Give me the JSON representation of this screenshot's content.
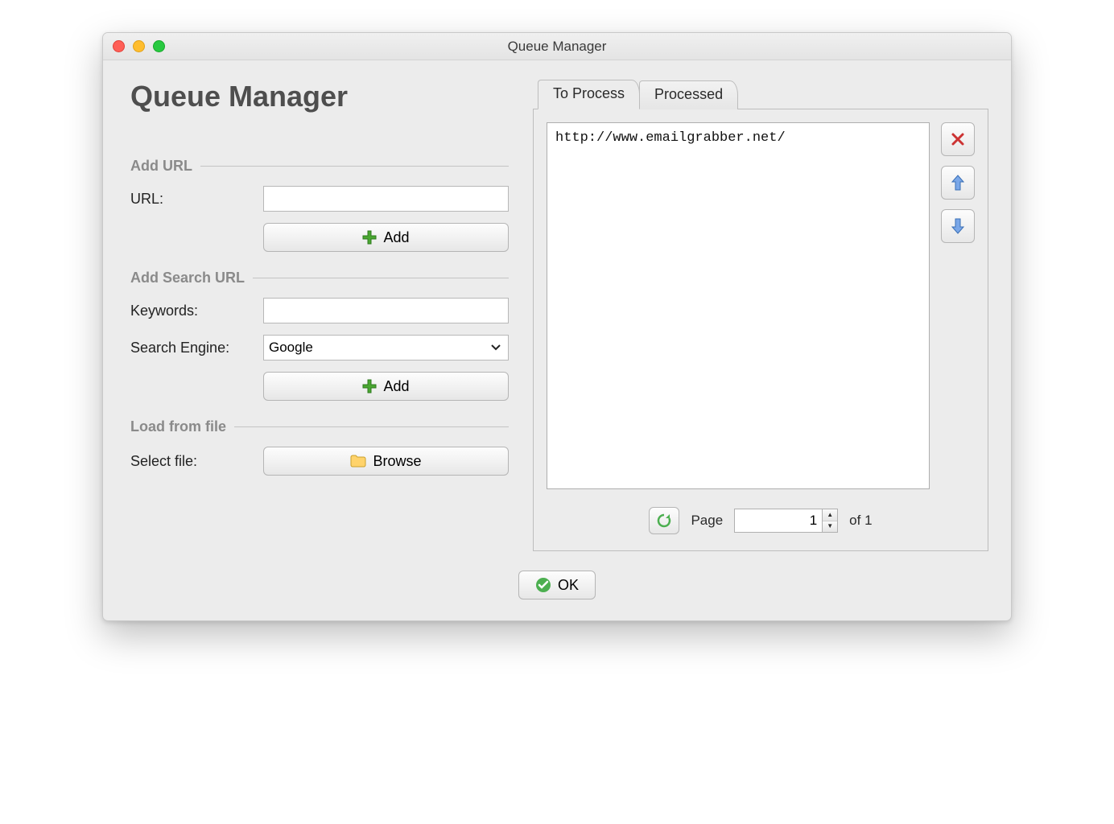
{
  "window": {
    "title": "Queue Manager"
  },
  "page_title": "Queue Manager",
  "sections": {
    "add_url": {
      "header": "Add URL",
      "url_label": "URL:",
      "url_value": "",
      "add_btn": "Add"
    },
    "add_search": {
      "header": "Add Search URL",
      "keywords_label": "Keywords:",
      "keywords_value": "",
      "engine_label": "Search Engine:",
      "engine_selected": "Google",
      "add_btn": "Add"
    },
    "load_file": {
      "header": "Load from file",
      "select_label": "Select file:",
      "browse_btn": "Browse"
    }
  },
  "tabs": {
    "to_process": "To Process",
    "processed": "Processed",
    "active": "to_process"
  },
  "queue": {
    "items": [
      "http://www.emailgrabber.net/"
    ]
  },
  "pager": {
    "label": "Page",
    "current": "1",
    "of_label": "of 1"
  },
  "footer": {
    "ok": "OK"
  }
}
